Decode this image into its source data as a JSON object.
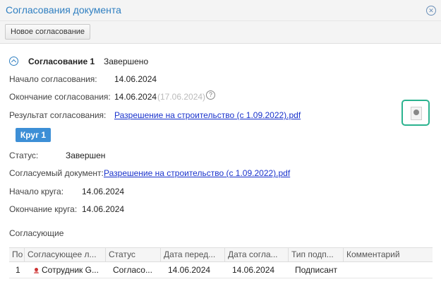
{
  "window": {
    "title": "Согласования документа"
  },
  "toolbar": {
    "new_label": "Новое согласование"
  },
  "approval": {
    "name": "Согласование 1",
    "status": "Завершено",
    "start_label": "Начало согласования:",
    "start_value": "14.06.2024",
    "end_label": "Окончание согласования:",
    "end_value": "14.06.2024",
    "end_planned": "(17.06.2024)",
    "result_label": "Результат согласования:",
    "result_link": "Разрешение на строительство (с 1.09.2022).pdf"
  },
  "round": {
    "badge": "Круг 1",
    "status_label": "Статус:",
    "status_value": "Завершен",
    "doc_label": "Согласуемый документ:",
    "doc_link": "Разрешение на строительство (с 1.09.2022).pdf",
    "start_label": "Начало круга:",
    "start_value": "14.06.2024",
    "end_label": "Окончание круга:",
    "end_value": "14.06.2024"
  },
  "approvers": {
    "title": "Согласующие",
    "columns": [
      "По",
      "Согласующее л...",
      "Статус",
      "Дата перед...",
      "Дата согла...",
      "Тип подп...",
      "Комментарий"
    ],
    "rows": [
      {
        "num": "1",
        "person": "Сотрудник G...",
        "status": "Согласо...",
        "date_sent": "14.06.2024",
        "date_agreed": "14.06.2024",
        "type": "Подписант",
        "comment": ""
      }
    ]
  },
  "icons": {
    "close": "close-circle-icon",
    "toggle": "chevron-up-circle-icon",
    "help": "question-circle-icon",
    "stamp": "seal-stamp-icon",
    "person": "person-icon"
  }
}
